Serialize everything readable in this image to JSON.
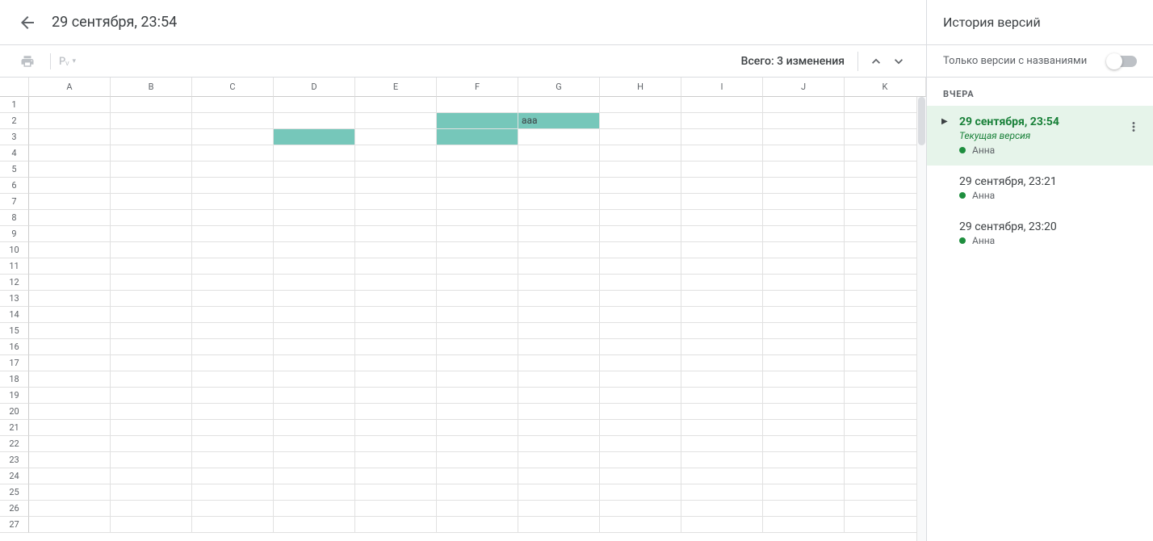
{
  "header": {
    "title": "29 сентября, 23:54"
  },
  "toolbar": {
    "pv_label": "Pᵥ",
    "changes_summary": "Всего: 3 изменения"
  },
  "sheet": {
    "columns": [
      "A",
      "B",
      "C",
      "D",
      "E",
      "F",
      "G",
      "H",
      "I",
      "J",
      "K"
    ],
    "row_count": 27,
    "highlighted_cells": [
      {
        "row": 2,
        "col": "F"
      },
      {
        "row": 2,
        "col": "G"
      },
      {
        "row": 3,
        "col": "D"
      },
      {
        "row": 3,
        "col": "F"
      }
    ],
    "cell_values": {
      "2_G": "aaa"
    }
  },
  "sidebar": {
    "title": "История версий",
    "filter_label": "Только версии с названиями",
    "date_group": "ВЧЕРА",
    "versions": [
      {
        "title": "29 сентября, 23:54",
        "subtitle": "Текущая версия",
        "author": "Анна",
        "active": true
      },
      {
        "title": "29 сентября, 23:21",
        "subtitle": "",
        "author": "Анна",
        "active": false
      },
      {
        "title": "29 сентября, 23:20",
        "subtitle": "",
        "author": "Анна",
        "active": false
      }
    ]
  }
}
